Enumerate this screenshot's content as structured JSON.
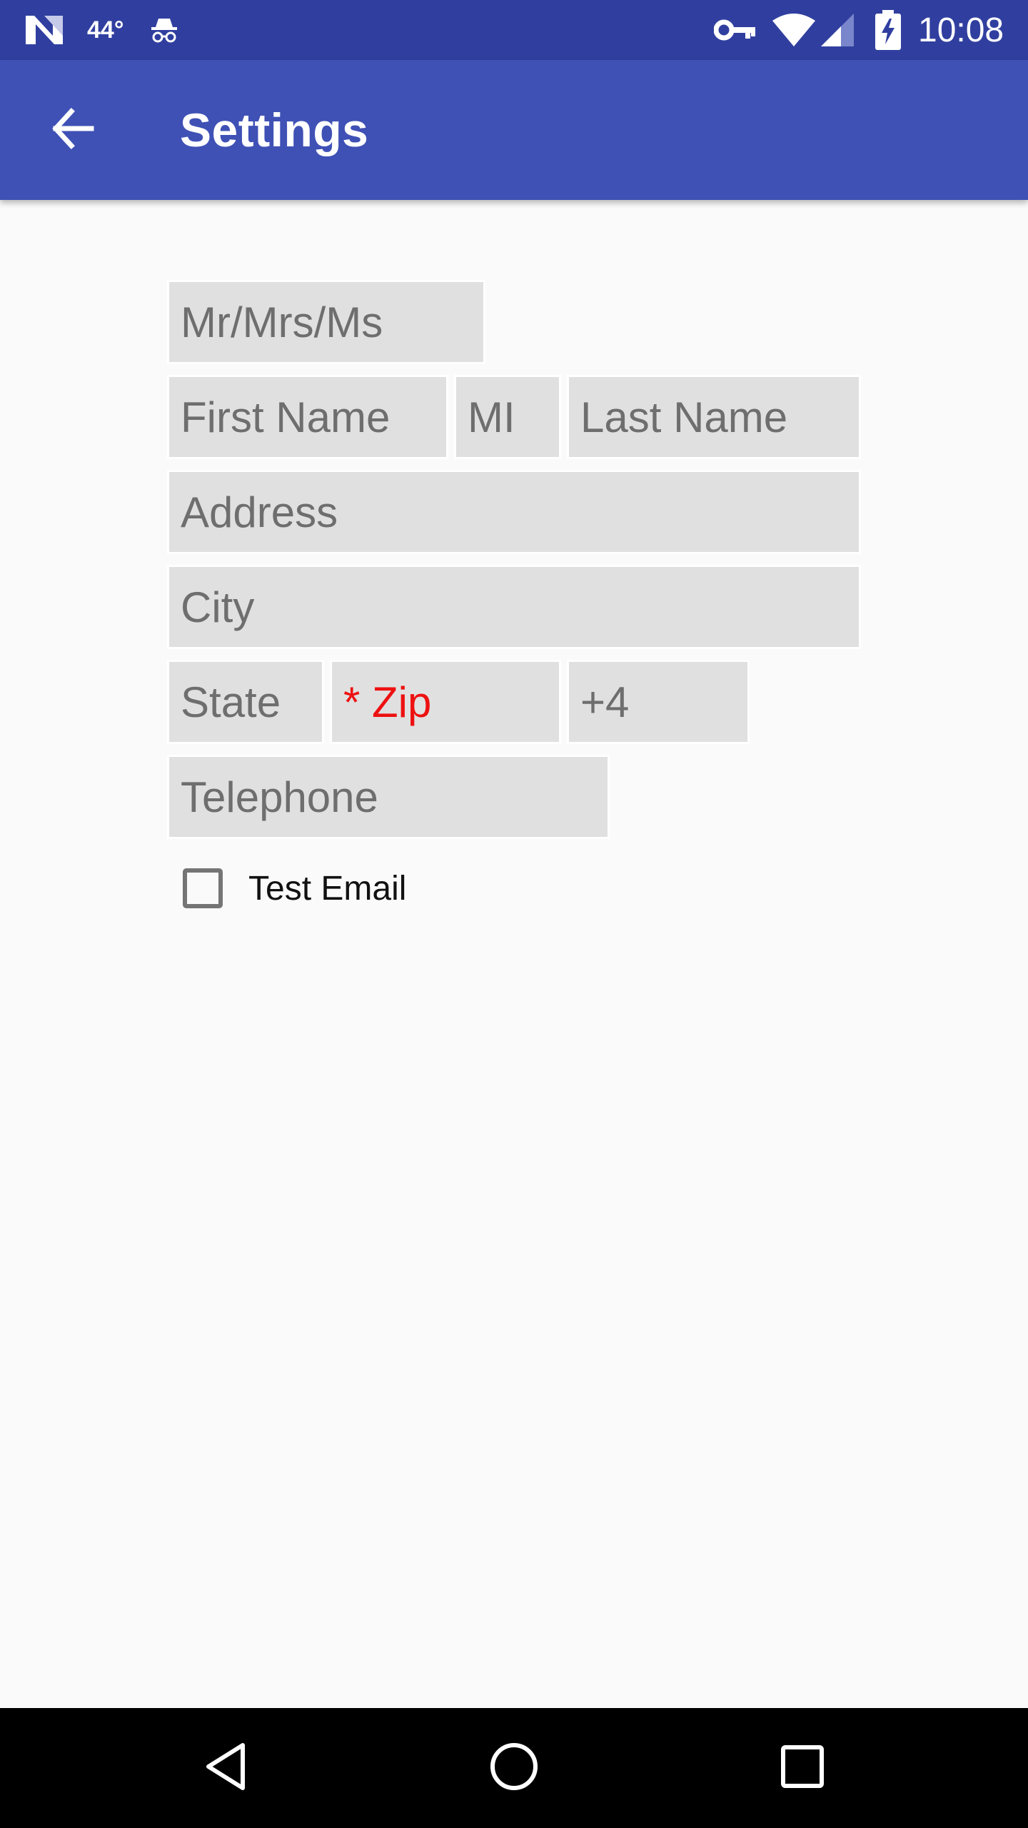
{
  "status_bar": {
    "temperature": "44°",
    "time": "10:08",
    "icons": [
      "n-logo-icon",
      "spy-icon",
      "vpn-key-icon",
      "wifi-icon",
      "cell-signal-icon",
      "battery-charging-icon"
    ]
  },
  "app_bar": {
    "title": "Settings",
    "back_icon": "arrow-back-icon"
  },
  "form": {
    "salutation_placeholder": "Mr/Mrs/Ms",
    "first_name_placeholder": "First Name",
    "middle_initial_placeholder": "MI",
    "last_name_placeholder": "Last Name",
    "address_placeholder": "Address",
    "city_placeholder": "City",
    "state_placeholder": "State",
    "zip_placeholder": "* Zip",
    "zip4_placeholder": "+4",
    "telephone_placeholder": "Telephone",
    "test_email_label": "Test Email",
    "test_email_checked": false
  },
  "colors": {
    "status_bar": "#303f9f",
    "app_bar": "#3f51b5",
    "field_bg": "#e0e0e0",
    "placeholder": "#6e6e6e",
    "required": "#ee1111"
  },
  "nav_bar": {
    "icons": [
      "back-triangle-icon",
      "home-circle-icon",
      "recents-square-icon"
    ]
  }
}
